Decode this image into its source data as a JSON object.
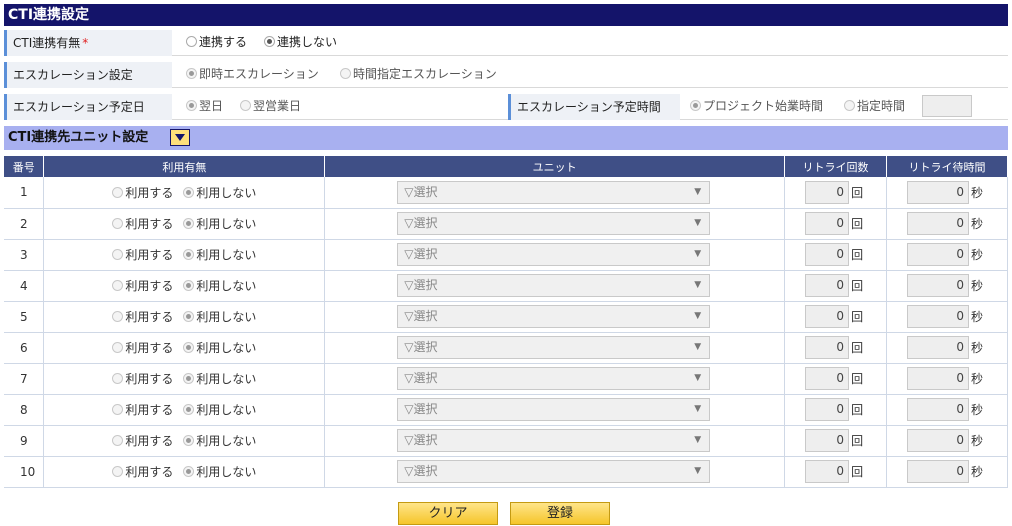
{
  "title": "CTI連携設定",
  "cti_link": {
    "label": "CTI連携有無",
    "required_mark": "*",
    "option_on": "連携する",
    "option_off": "連携しない"
  },
  "escalation": {
    "label": "エスカレーション設定",
    "option_immediate": "即時エスカレーション",
    "option_scheduled": "時間指定エスカレーション"
  },
  "escalation_date": {
    "label": "エスカレーション予定日",
    "option_next_day": "翌日",
    "option_next_business_day": "翌営業日"
  },
  "escalation_time": {
    "label": "エスカレーション予定時間",
    "option_project_start": "プロジェクト始業時間",
    "option_specified": "指定時間",
    "time_value": ""
  },
  "unit_section": {
    "title": "CTI連携先ユニット設定"
  },
  "table": {
    "headers": [
      "番号",
      "利用有無",
      "ユニット",
      "リトライ回数",
      "リトライ待時間"
    ],
    "use_label": "利用する",
    "nouse_label": "利用しない",
    "select_placeholder": "▽選択",
    "count_unit": "回",
    "wait_unit": "秒",
    "rows": [
      {
        "no": "1",
        "retry": "0",
        "wait": "0"
      },
      {
        "no": "2",
        "retry": "0",
        "wait": "0"
      },
      {
        "no": "3",
        "retry": "0",
        "wait": "0"
      },
      {
        "no": "4",
        "retry": "0",
        "wait": "0"
      },
      {
        "no": "5",
        "retry": "0",
        "wait": "0"
      },
      {
        "no": "6",
        "retry": "0",
        "wait": "0"
      },
      {
        "no": "7",
        "retry": "0",
        "wait": "0"
      },
      {
        "no": "8",
        "retry": "0",
        "wait": "0"
      },
      {
        "no": "9",
        "retry": "0",
        "wait": "0"
      },
      {
        "no": "10",
        "retry": "0",
        "wait": "0"
      }
    ]
  },
  "buttons": {
    "clear": "クリア",
    "register": "登録"
  }
}
